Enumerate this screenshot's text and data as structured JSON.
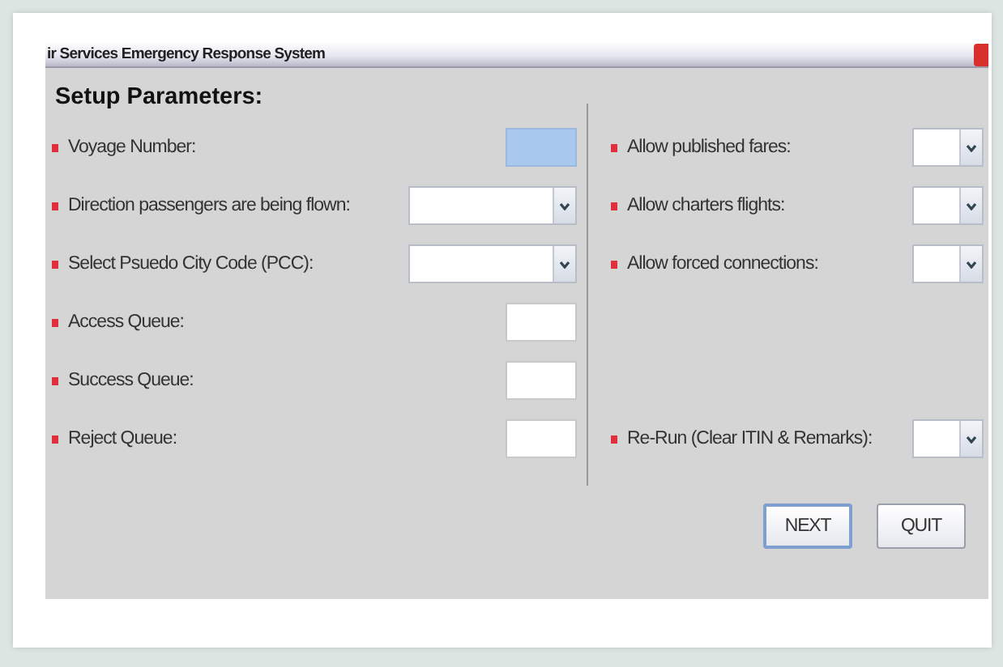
{
  "window": {
    "title": "ir Services Emergency Response System"
  },
  "heading": "Setup Parameters:",
  "left_fields": [
    {
      "label": "Voyage Number:",
      "kind": "text",
      "required": true,
      "focused": true
    },
    {
      "label": "Direction passengers are being flown:",
      "kind": "select",
      "required": true
    },
    {
      "label": "Select Psuedo City Code (PCC):",
      "kind": "select",
      "required": true
    },
    {
      "label": "Access Queue:",
      "kind": "text",
      "required": true,
      "focused": false
    },
    {
      "label": "Success Queue:",
      "kind": "text",
      "required": true,
      "focused": false
    },
    {
      "label": "Reject Queue:",
      "kind": "text",
      "required": true,
      "focused": false
    }
  ],
  "right_fields": [
    {
      "label": "Allow published fares:",
      "kind": "select",
      "required": true
    },
    {
      "label": "Allow charters flights:",
      "kind": "select",
      "required": true
    },
    {
      "label": "Allow forced connections:",
      "kind": "select",
      "required": true
    },
    {
      "label": "Re-Run (Clear ITIN & Remarks):",
      "kind": "select",
      "required": true
    }
  ],
  "buttons": [
    {
      "label": "NEXT",
      "default": true
    },
    {
      "label": "QUIT",
      "default": false
    }
  ]
}
